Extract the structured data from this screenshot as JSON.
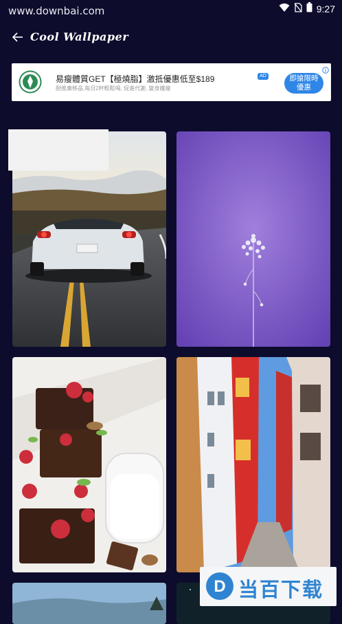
{
  "status_bar": {
    "watermark": "www.downbai.com",
    "time": "9:27"
  },
  "app_bar": {
    "title": "Cool Wallpaper"
  },
  "ad": {
    "title": "易瘦體質GET【極燒脂】激抵優惠低至$189",
    "subtitle": "耐推廣移品,每日2杯輕鬆喝, 促進代謝, 變身纖瘦",
    "badge": "AD",
    "cta": "即搶限時優惠"
  },
  "wallpapers": [
    "car",
    "flower",
    "dessert",
    "street",
    "landscape",
    "night"
  ],
  "bottom_watermark": {
    "logo_letter": "D",
    "text": "当百下载"
  },
  "colors": {
    "background": "#0d0c2c",
    "ad_accent": "#2f86e6",
    "watermark_blue": "#2f84d1"
  }
}
